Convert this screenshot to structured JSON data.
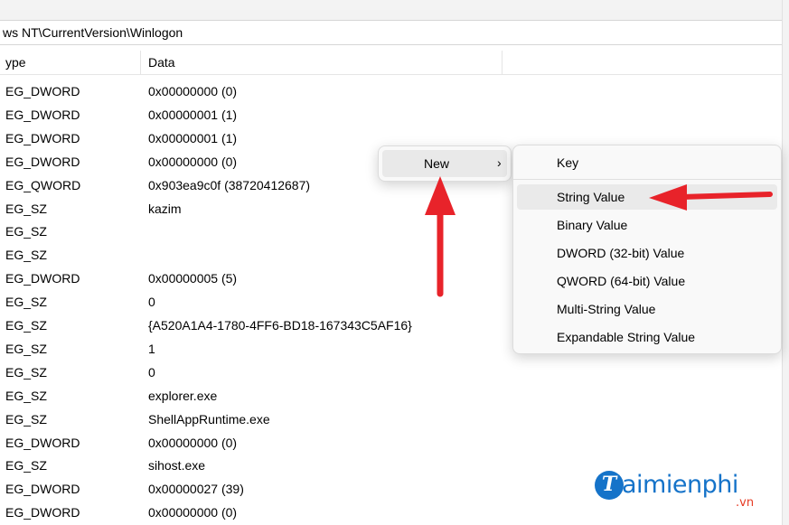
{
  "address": {
    "path": "ws NT\\CurrentVersion\\Winlogon"
  },
  "columns": {
    "type": "ype",
    "data": "Data"
  },
  "rows": [
    {
      "type": "EG_DWORD",
      "data": "0x00000000 (0)"
    },
    {
      "type": "EG_DWORD",
      "data": "0x00000001 (1)"
    },
    {
      "type": "EG_DWORD",
      "data": "0x00000001 (1)"
    },
    {
      "type": "EG_DWORD",
      "data": "0x00000000 (0)"
    },
    {
      "type": "EG_QWORD",
      "data": "0x903ea9c0f (38720412687)"
    },
    {
      "type": "EG_SZ",
      "data": "kazim"
    },
    {
      "type": "EG_SZ",
      "data": ""
    },
    {
      "type": "EG_SZ",
      "data": ""
    },
    {
      "type": "EG_DWORD",
      "data": "0x00000005 (5)"
    },
    {
      "type": "EG_SZ",
      "data": "0"
    },
    {
      "type": "EG_SZ",
      "data": "{A520A1A4-1780-4FF6-BD18-167343C5AF16}"
    },
    {
      "type": "EG_SZ",
      "data": "1"
    },
    {
      "type": "EG_SZ",
      "data": "0"
    },
    {
      "type": "EG_SZ",
      "data": "explorer.exe"
    },
    {
      "type": "EG_SZ",
      "data": "ShellAppRuntime.exe"
    },
    {
      "type": "EG_DWORD",
      "data": "0x00000000 (0)"
    },
    {
      "type": "EG_SZ",
      "data": "sihost.exe"
    },
    {
      "type": "EG_DWORD",
      "data": "0x00000027 (39)"
    },
    {
      "type": "EG_DWORD",
      "data": "0x00000000 (0)"
    }
  ],
  "context_menu": {
    "new_label": "New",
    "chevron": "›"
  },
  "submenu": {
    "items": [
      {
        "label": "Key"
      },
      {
        "label": "String Value"
      },
      {
        "label": "Binary Value"
      },
      {
        "label": "DWORD (32-bit) Value"
      },
      {
        "label": "QWORD (64-bit) Value"
      },
      {
        "label": "Multi-String Value"
      },
      {
        "label": "Expandable String Value"
      }
    ],
    "highlighted": "String Value"
  },
  "annotation_color": "#e8232a",
  "watermark": {
    "icon_letter": "T",
    "brand": "aimienphi",
    "tld": ".vn"
  }
}
